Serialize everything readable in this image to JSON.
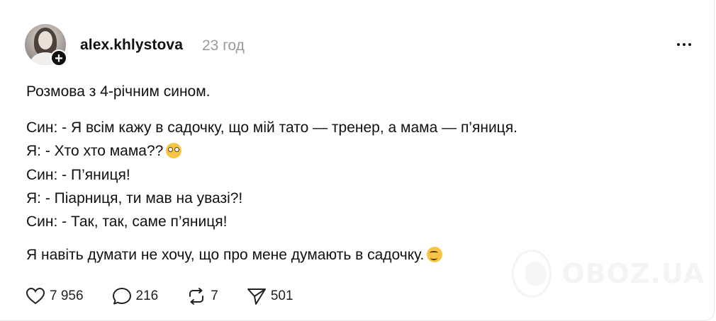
{
  "post": {
    "username": "alex.khlystova",
    "timeago": "23 год",
    "follow_symbol": "+",
    "lines": [
      "Розмова з 4-річним сином.",
      "Син: - Я всім кажу в садочку, що мій тато — тренер, а мама — п’яниця.",
      "Я: - Хто хто мама??",
      "Син: - П’яниця!",
      "Я: - Піарниця, ти мав на увазі?!",
      "Син: - Так, так, саме п’яниця!",
      "Я навіть думати не хочу, що про мене думають в садочку."
    ],
    "emojis": {
      "line_3": "flushed-face-emoji",
      "line_7": "woozy-face-emoji"
    }
  },
  "actions": {
    "likes": "7 956",
    "comments": "216",
    "reposts": "7",
    "shares": "501"
  },
  "watermark": {
    "text": "OBOZ.UA"
  },
  "icons": {
    "like": "heart-icon",
    "comment": "speech-bubble-icon",
    "repost": "repost-arrows-icon",
    "share": "paper-plane-icon",
    "more": "ellipsis-icon"
  },
  "colors": {
    "text": "#111111",
    "muted": "#9a9a9a",
    "watermark": "#ececec"
  }
}
